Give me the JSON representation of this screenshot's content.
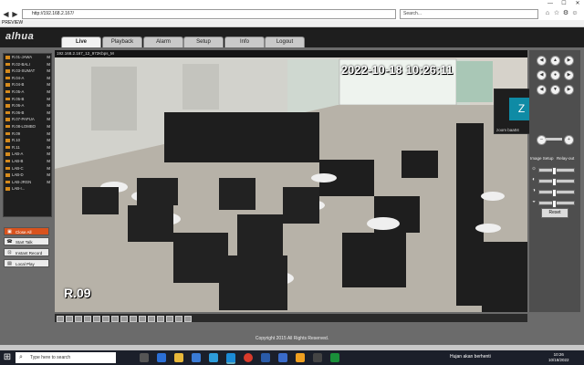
{
  "browser": {
    "tab_title": "PREVIEW",
    "url": "http://192.168.2.167/",
    "search_placeholder": "Search..."
  },
  "app": {
    "logo": "alhua",
    "tabs": [
      "Live",
      "Playback",
      "Alarm",
      "Setup",
      "Info",
      "Logout"
    ],
    "active_tab": "Live"
  },
  "channels": [
    {
      "label": "R.01-JAWA",
      "tag": "M"
    },
    {
      "label": "R.02-BALI",
      "tag": "M"
    },
    {
      "label": "R.03-SUMAT",
      "tag": "M"
    },
    {
      "label": "R.04-A",
      "tag": "M"
    },
    {
      "label": "R.04-B",
      "tag": "M"
    },
    {
      "label": "R.05-A",
      "tag": "M"
    },
    {
      "label": "R.05-B",
      "tag": "M"
    },
    {
      "label": "R.06-A",
      "tag": "M"
    },
    {
      "label": "R.06-B",
      "tag": "M"
    },
    {
      "label": "R.07-PAPUA",
      "tag": "M"
    },
    {
      "label": "R.08-LOMBO",
      "tag": "M"
    },
    {
      "label": "R.09",
      "tag": "M"
    },
    {
      "label": "R.10",
      "tag": "M"
    },
    {
      "label": "R.11",
      "tag": "M"
    },
    {
      "label": "LAB-A",
      "tag": "M"
    },
    {
      "label": "LAB-B",
      "tag": "M"
    },
    {
      "label": "LAB-C",
      "tag": "M"
    },
    {
      "label": "LAB-D",
      "tag": "M"
    },
    {
      "label": "LAB-JRGN",
      "tag": "M"
    },
    {
      "label": "LAB-I...",
      "tag": ""
    }
  ],
  "left_buttons": [
    "Close All",
    "Start Talk",
    "Instant Record",
    "Local Play"
  ],
  "video": {
    "stream_info": "192.168.2.167_12_972Kbps_M",
    "timestamp": "2022-10-18  10:26:11",
    "camera_name": "R.09"
  },
  "zoom_tile": {
    "letter": "Z",
    "label": "zoom baa04"
  },
  "right_panel": {
    "image_setup": "Image Setup",
    "relay_out": "Relay-out",
    "reset": "Reset",
    "ptz_buttons": [
      "◀",
      "▲",
      "▶",
      "◀",
      "●",
      "▶",
      "◀",
      "▼",
      "▶"
    ]
  },
  "footer": {
    "copyright": "Copyright 2015 All Rights Reserved."
  },
  "taskbar": {
    "search_placeholder": "Type here to search",
    "weather": "Hujan akan berhenti",
    "time": "10:26",
    "date": "10/18/2022"
  },
  "colors": {
    "accent": "#d9531e",
    "zoom": "#0f8ba5"
  }
}
